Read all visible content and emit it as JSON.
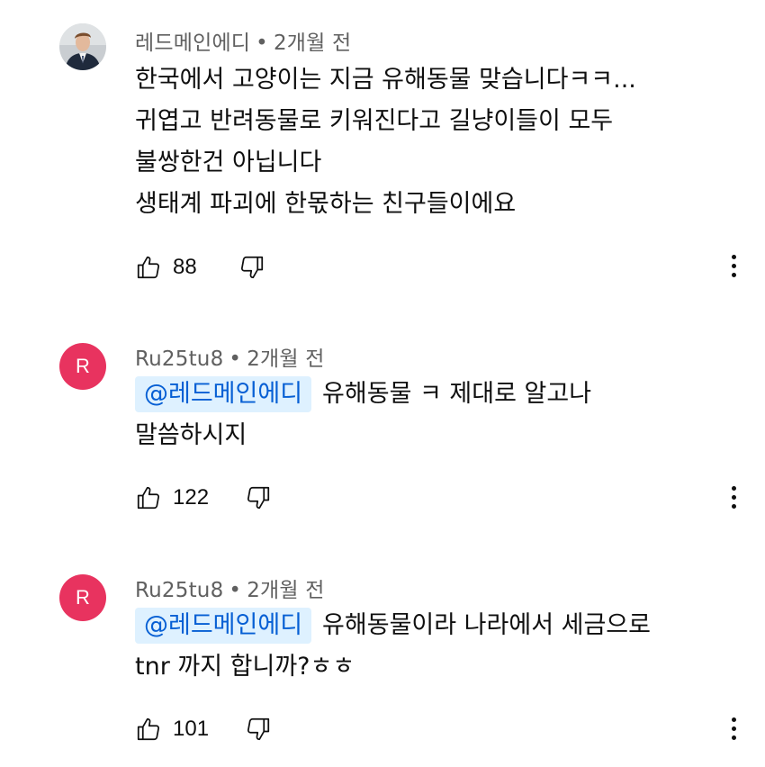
{
  "comments": [
    {
      "author": "레드메인에디",
      "separator": "•",
      "time": "2개월 전",
      "mention": "",
      "lines": [
        "한국에서 고양이는 지금 유해동물 맞습니다ㅋㅋ...",
        "귀엽고 반려동물로 키워진다고 길냥이들이 모두",
        "불쌍한건 아닙니다",
        "생태계 파괴에 한몫하는 친구들이에요"
      ],
      "likes": "88",
      "avatar": "portrait-photo"
    },
    {
      "author": "Ru25tu8",
      "separator": "•",
      "time": "2개월 전",
      "avatar_letter": "R",
      "mention": "@레드메인에디",
      "lines": [
        "유해동물 ㅋ 제대로 알고나",
        "말씀하시지"
      ],
      "likes": "122"
    },
    {
      "author": "Ru25tu8",
      "separator": "•",
      "time": "2개월 전",
      "avatar_letter": "R",
      "mention": "@레드메인에디",
      "lines": [
        "유해동물이라 나라에서 세금으로",
        "tnr 까지 합니까?ㅎㅎ"
      ],
      "likes": "101"
    }
  ],
  "icons": {
    "like": "thumbs-up-icon",
    "dislike": "thumbs-down-icon",
    "more": "more-vertical-icon"
  },
  "colors": {
    "avatar_bg": "#e8335f",
    "mention_bg": "#def1ff",
    "mention_text": "#065fd4",
    "meta_text": "#606060"
  }
}
